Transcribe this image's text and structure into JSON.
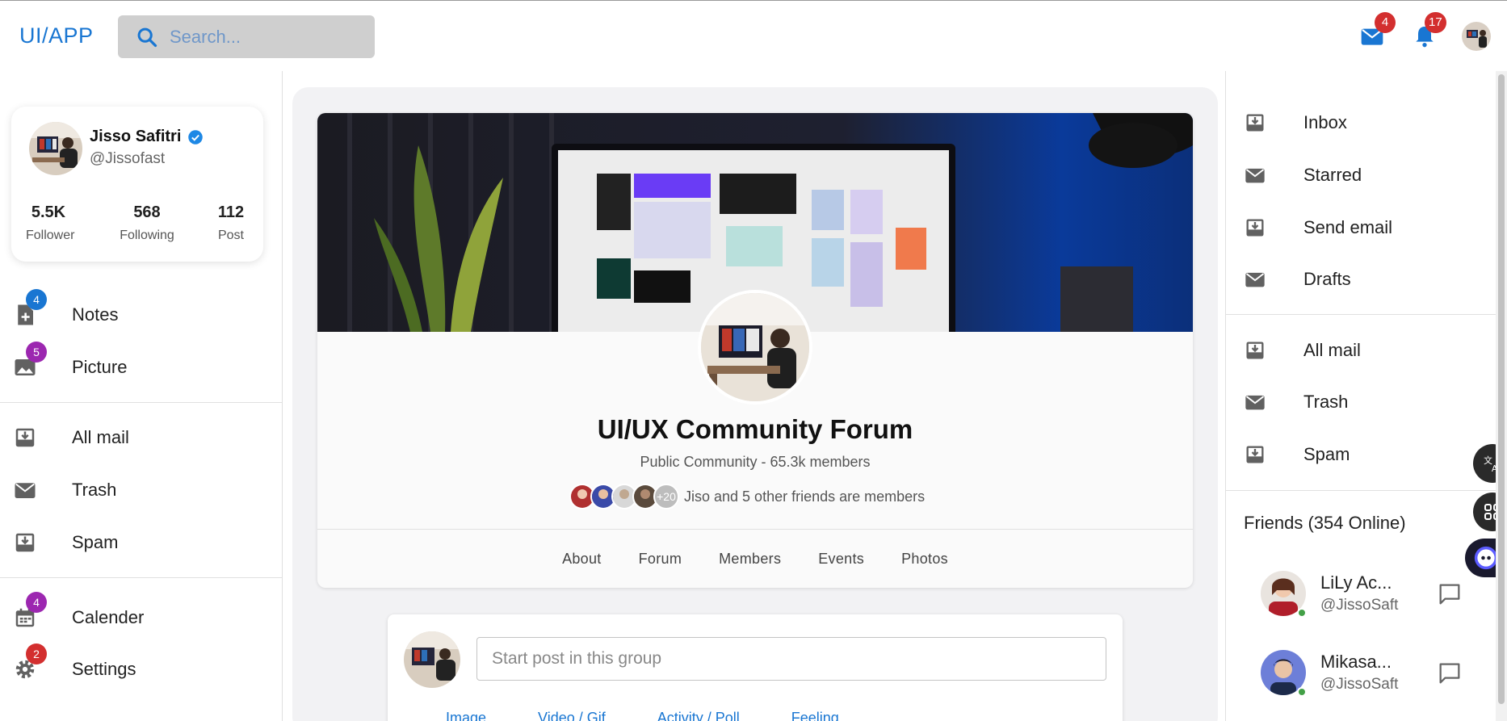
{
  "app": {
    "logo": "UI/APP"
  },
  "search": {
    "placeholder": "Search..."
  },
  "header": {
    "mail_badge": "4",
    "notifications_badge": "17"
  },
  "profile": {
    "name": "Jisso Safitri",
    "handle": "@Jissofast",
    "stats": [
      {
        "value": "5.5K",
        "label": "Follower"
      },
      {
        "value": "568",
        "label": "Following"
      },
      {
        "value": "112",
        "label": "Post"
      }
    ]
  },
  "left_nav": {
    "notes": {
      "label": "Notes",
      "badge": "4"
    },
    "picture": {
      "label": "Picture",
      "badge": "5"
    },
    "all_mail": {
      "label": "All mail"
    },
    "trash": {
      "label": "Trash"
    },
    "spam": {
      "label": "Spam"
    },
    "calender": {
      "label": "Calender",
      "badge": "4"
    },
    "settings": {
      "label": "Settings",
      "badge": "2"
    }
  },
  "group": {
    "title": "UI/UX Community Forum",
    "subtitle": "Public Community - 65.3k members",
    "members_count_badge": "+20",
    "members_text": "Jiso and 5 other friends are members",
    "tabs": [
      "About",
      "Forum",
      "Members",
      "Events",
      "Photos"
    ]
  },
  "composer": {
    "placeholder": "Start post in this group",
    "actions": [
      "Image",
      "Video / Gif",
      "Activity / Poll",
      "Feeling"
    ]
  },
  "right_nav": {
    "inbox": "Inbox",
    "starred": "Starred",
    "send_email": "Send email",
    "drafts": "Drafts",
    "all_mail": "All mail",
    "trash": "Trash",
    "spam": "Spam"
  },
  "friends": {
    "title": "Friends (354 Online)",
    "list": [
      {
        "name": "LiLy Ac...",
        "handle": "@JissoSaft"
      },
      {
        "name": "Mikasa...",
        "handle": "@JissoSaft"
      }
    ]
  },
  "colors": {
    "accent": "#1976d2",
    "badge_red": "#d32f2f",
    "badge_blue": "#1976d2",
    "badge_purple": "#9c27b0",
    "online": "#43a047"
  }
}
